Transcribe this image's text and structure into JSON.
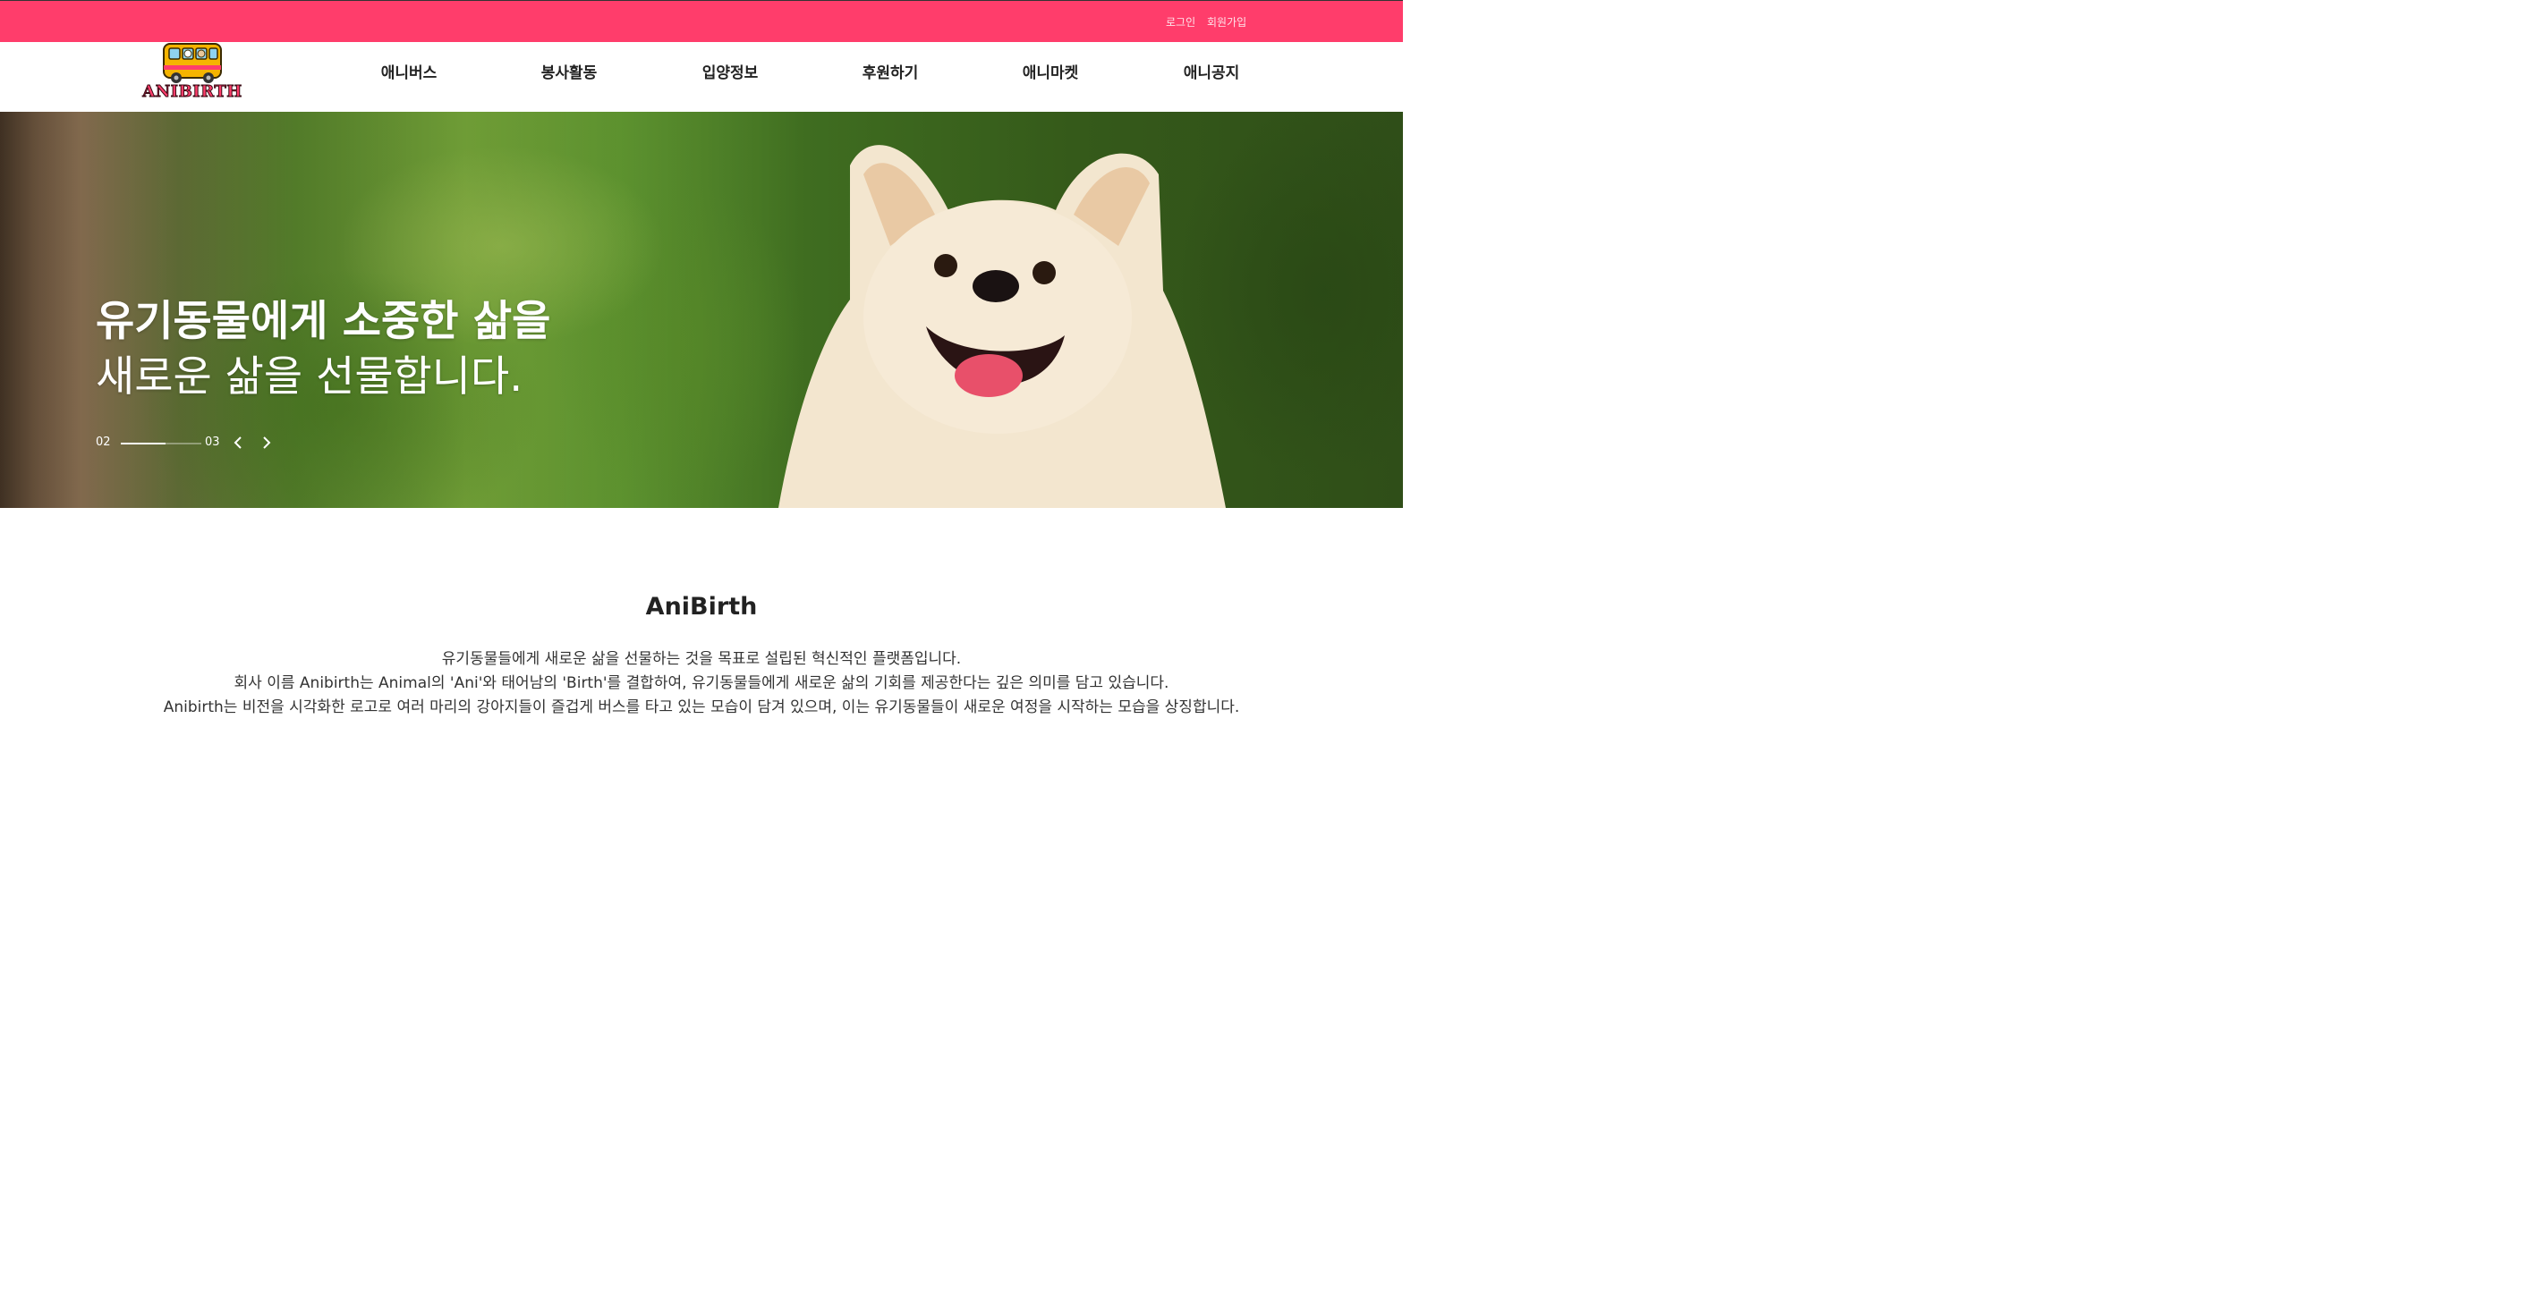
{
  "header": {
    "login": "로그인",
    "signup": "회원가입",
    "logo_text": "ANIBIRTH",
    "brand_color": "#ff3d6b",
    "menu": [
      {
        "label": "애니버스"
      },
      {
        "label": "봉사활동"
      },
      {
        "label": "입양정보"
      },
      {
        "label": "후원하기"
      },
      {
        "label": "애니마켓"
      },
      {
        "label": "애니공지"
      }
    ]
  },
  "hero": {
    "title_line1": "유기동물에게 소중한 삶을",
    "title_line2": "새로운 삶을 선물합니다.",
    "slide_current": "02",
    "slide_total": "03",
    "progress": 0.55,
    "prev_icon": "chevron-left-icon",
    "next_icon": "chevron-right-icon"
  },
  "about": {
    "title": "AniBirth",
    "lines": [
      "유기동물들에게 새로운 삶을 선물하는 것을 목표로 설립된 혁신적인 플랫폼입니다.",
      "회사 이름 Anibirth는 Animal의 'Ani'와 태어남의 'Birth'를 결합하여, 유기동물들에게 새로운 삶의 기회를 제공한다는 깊은 의미를 담고 있습니다.",
      "Anibirth는 비전을 시각화한 로고로 여러 마리의 강아지들이 즐겁게 버스를 타고 있는 모습이 담겨 있으며, 이는 유기동물들이 새로운 여정을 시작하는 모습을 상징합니다."
    ]
  }
}
